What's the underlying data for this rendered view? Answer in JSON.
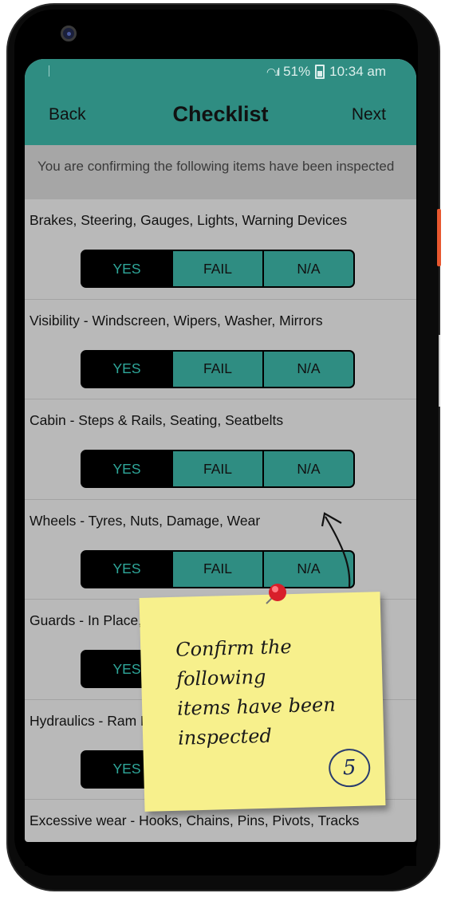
{
  "status_bar": {
    "battery": "51%",
    "time": "10:34 am"
  },
  "nav": {
    "back": "Back",
    "title": "Checklist",
    "next": "Next"
  },
  "info": "You are confirming the following items have been inspected",
  "options": {
    "yes": "YES",
    "fail": "FAIL",
    "na": "N/A"
  },
  "checklist": [
    {
      "label": "Brakes, Steering, Gauges, Lights, Warning Devices"
    },
    {
      "label": "Visibility - Windscreen, Wipers, Washer, Mirrors"
    },
    {
      "label": "Cabin - Steps & Rails, Seating, Seatbelts"
    },
    {
      "label": "Wheels - Tyres, Nuts, Damage, Wear"
    },
    {
      "label": "Guards - In Place, Secure, Warning Signs"
    },
    {
      "label": "Hydraulics - Ram Hoses, Leaks, Wear, Pressure"
    },
    {
      "label": "Excessive wear - Hooks, Chains, Pins, Pivots, Tracks"
    }
  ],
  "note": {
    "text": "Confirm the\nfollowing\nitems have been\ninspected",
    "step": "5"
  },
  "colors": {
    "teal": "#2f8d82",
    "yes_text": "#2fa89b",
    "screen_bg": "#b9b9b9",
    "note": "#f7f08c"
  }
}
